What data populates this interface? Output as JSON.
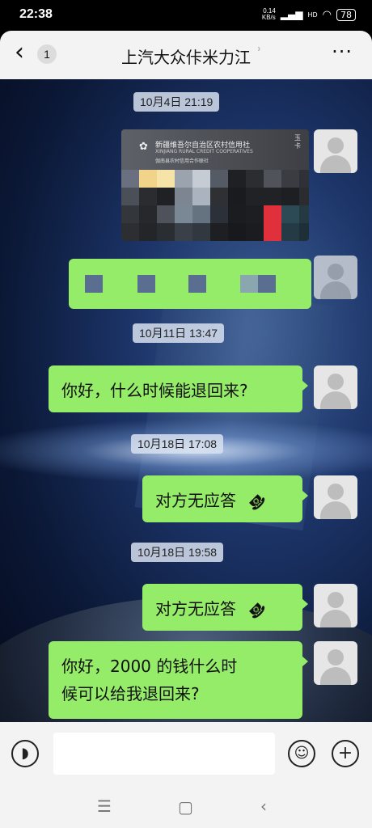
{
  "status_bar": {
    "time": "22:38",
    "net_speed": "0.14",
    "net_unit": "KB/s",
    "hd": "HD",
    "battery": "78"
  },
  "header": {
    "back_icon": "chevron-left-icon",
    "unread_count": "1",
    "title": "上汽大众佧米力江",
    "voice_icon": "ear-icon",
    "more_icon": "more-dots-icon"
  },
  "messages": {
    "ts1": "10月4日 21:19",
    "card": {
      "bank_name": "新疆维吾尔自治区农村信用社",
      "bank_en": "XINJIANG RURAL CREDIT COOPERATIVES",
      "branch": "伽南县农村信用合作联社",
      "side_text": "玉卡"
    },
    "ts2": "10月11日 13:47",
    "msg3": "你好，什么时候能退回来?",
    "ts3": "10月18日 17:08",
    "call1": "对方无应答",
    "ts4": "10月18日 19:58",
    "call2": "对方无应答",
    "msg6_line1": "你好，2000 的钱什么时",
    "msg6_line2": "候可以给我退回来?"
  },
  "input_bar": {
    "voice_icon": "voice-icon",
    "emoji_icon": "emoji-icon",
    "add_icon": "add-icon"
  },
  "nav_bar": {
    "menu_icon": "menu-icon",
    "home_icon": "home-icon",
    "back_icon": "back-icon"
  },
  "colors": {
    "bubble": "#95ec69",
    "header_bg": "#f3f3f3"
  }
}
